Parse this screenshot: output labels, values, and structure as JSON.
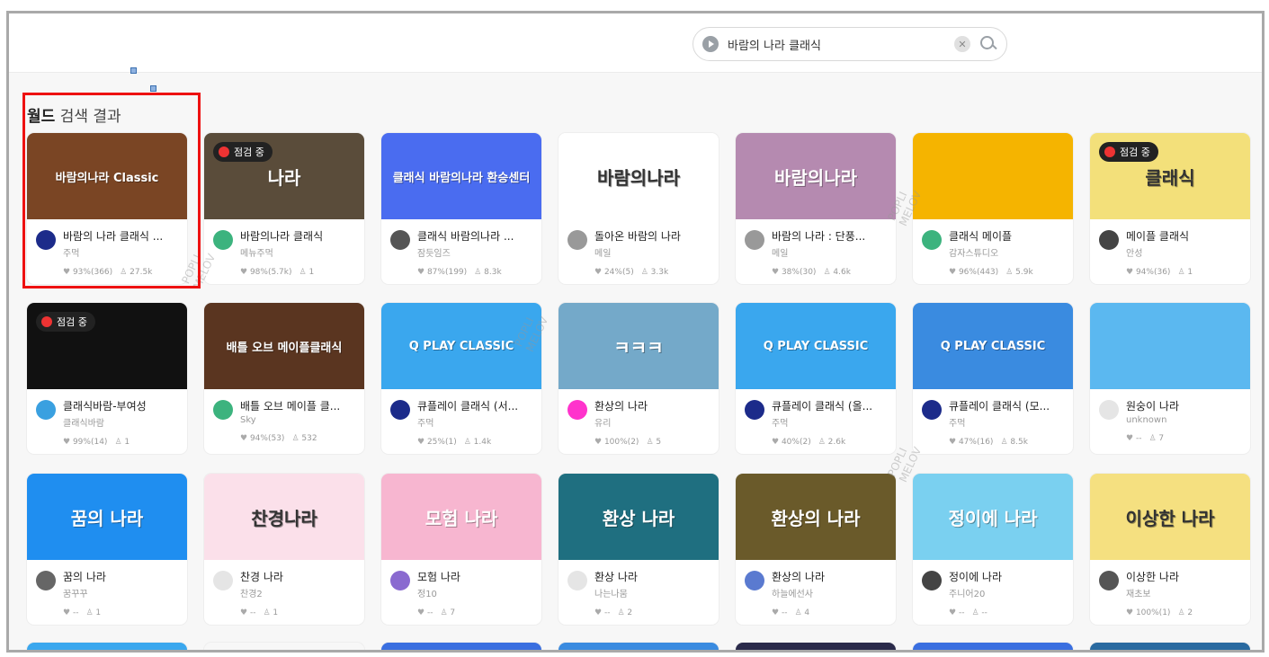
{
  "search": {
    "value": "바람의 나라 클래식"
  },
  "heading": {
    "bold": "월드",
    "rest": "검색 결과"
  },
  "watermark": "POPLI\nMELOV",
  "cards": [
    {
      "title": "바람의 나라 클래식 ...",
      "creator": "주먹",
      "like": "93%(366)",
      "users": "27.5k",
      "thumb_text": "바람의나라 Classic",
      "thumb_color": "#7a4524",
      "badge": "",
      "avatar_color": "#1c2b8a"
    },
    {
      "title": "바람의나라 클래식",
      "creator": "메뉴주먹",
      "like": "98%(5.7k)",
      "users": "1",
      "thumb_text": "나라",
      "thumb_color": "#5a4c3a",
      "badge": "점검 중",
      "avatar_color": "#3cb37e"
    },
    {
      "title": "클래식 바람의나라 ...",
      "creator": "잠듯임즈",
      "like": "87%(199)",
      "users": "8.3k",
      "thumb_text": "클래식 바람의나라 환승센터",
      "thumb_color": "#4a6cf0",
      "badge": "",
      "avatar_color": "#555"
    },
    {
      "title": "돌아온 바람의 나라",
      "creator": "메일",
      "like": "24%(5)",
      "users": "3.3k",
      "thumb_text": "바람의나라",
      "thumb_color": "#ffffff",
      "badge": "",
      "avatar_color": "#999"
    },
    {
      "title": "바람의 나라 : 단풍...",
      "creator": "메일",
      "like": "38%(30)",
      "users": "4.6k",
      "thumb_text": "바람의나라",
      "thumb_color": "#b58ab0",
      "badge": "",
      "avatar_color": "#999"
    },
    {
      "title": "클래식 메이플",
      "creator": "감자스튜디오",
      "like": "96%(443)",
      "users": "5.9k",
      "thumb_text": "",
      "thumb_color": "#f5b400",
      "badge": "",
      "avatar_color": "#3cb37e"
    },
    {
      "title": "메이플 클래식",
      "creator": "안성",
      "like": "94%(36)",
      "users": "1",
      "thumb_text": "클래식",
      "thumb_color": "#f3e07a",
      "badge": "점검 중",
      "avatar_color": "#444"
    },
    {
      "title": "클래식바람-부여성",
      "creator": "클래식바람",
      "like": "99%(14)",
      "users": "1",
      "thumb_text": "",
      "thumb_color": "#111111",
      "badge": "점검 중",
      "avatar_color": "#3aa0e0"
    },
    {
      "title": "배틀 오브 메이플 클...",
      "creator": "Sky",
      "like": "94%(53)",
      "users": "532",
      "thumb_text": "배틀 오브 메이플클래식",
      "thumb_color": "#5a3520",
      "badge": "",
      "avatar_color": "#3cb37e"
    },
    {
      "title": "큐플레이 클래식 (서...",
      "creator": "주먹",
      "like": "25%(1)",
      "users": "1.4k",
      "thumb_text": "Q PLAY CLASSIC",
      "thumb_color": "#3aa7ee",
      "badge": "",
      "avatar_color": "#1c2b8a"
    },
    {
      "title": "환상의 나라",
      "creator": "유리",
      "like": "100%(2)",
      "users": "5",
      "thumb_text": "ㅋㅋㅋ",
      "thumb_color": "#74a9c9",
      "badge": "",
      "avatar_color": "#f3c"
    },
    {
      "title": "큐플레이 클래식 (올...",
      "creator": "주먹",
      "like": "40%(2)",
      "users": "2.6k",
      "thumb_text": "Q PLAY CLASSIC",
      "thumb_color": "#3aa7ee",
      "badge": "",
      "avatar_color": "#1c2b8a"
    },
    {
      "title": "큐플레이 클래식 (모...",
      "creator": "주먹",
      "like": "47%(16)",
      "users": "8.5k",
      "thumb_text": "Q PLAY CLASSIC",
      "thumb_color": "#3a8be0",
      "badge": "",
      "avatar_color": "#1c2b8a"
    },
    {
      "title": "원숭이 나라",
      "creator": "unknown",
      "like": "--",
      "users": "7",
      "thumb_text": "",
      "thumb_color": "#5bb8f0",
      "badge": "",
      "avatar_color": "#e5e5e5"
    },
    {
      "title": "꿈의 나라",
      "creator": "꿈꾸꾸",
      "like": "--",
      "users": "1",
      "thumb_text": "꿈의 나라",
      "thumb_color": "#1f8ef0",
      "badge": "",
      "avatar_color": "#666"
    },
    {
      "title": "찬경 나라",
      "creator": "찬경2",
      "like": "--",
      "users": "1",
      "thumb_text": "찬경나라",
      "thumb_color": "#fbe0ea",
      "badge": "",
      "avatar_color": "#e5e5e5"
    },
    {
      "title": "모험 나라",
      "creator": "정10",
      "like": "--",
      "users": "7",
      "thumb_text": "모험 나라",
      "thumb_color": "#f7b6d0",
      "badge": "",
      "avatar_color": "#8a6ad0"
    },
    {
      "title": "환상 나라",
      "creator": "나는나뭄",
      "like": "--",
      "users": "2",
      "thumb_text": "환상 나라",
      "thumb_color": "#1f6f80",
      "badge": "",
      "avatar_color": "#e5e5e5"
    },
    {
      "title": "환상의 나라",
      "creator": "하늘에선사",
      "like": "--",
      "users": "4",
      "thumb_text": "환상의 나라",
      "thumb_color": "#6a5a2a",
      "badge": "",
      "avatar_color": "#5a7ad0"
    },
    {
      "title": "정이에 나라",
      "creator": "주니어20",
      "like": "--",
      "users": "--",
      "thumb_text": "정이에 나라",
      "thumb_color": "#7ad0f0",
      "badge": "",
      "avatar_color": "#444"
    },
    {
      "title": "이상한 나라",
      "creator": "재초보",
      "like": "100%(1)",
      "users": "2",
      "thumb_text": "이상한 나라",
      "thumb_color": "#f5e080",
      "badge": "",
      "avatar_color": "#555"
    }
  ]
}
